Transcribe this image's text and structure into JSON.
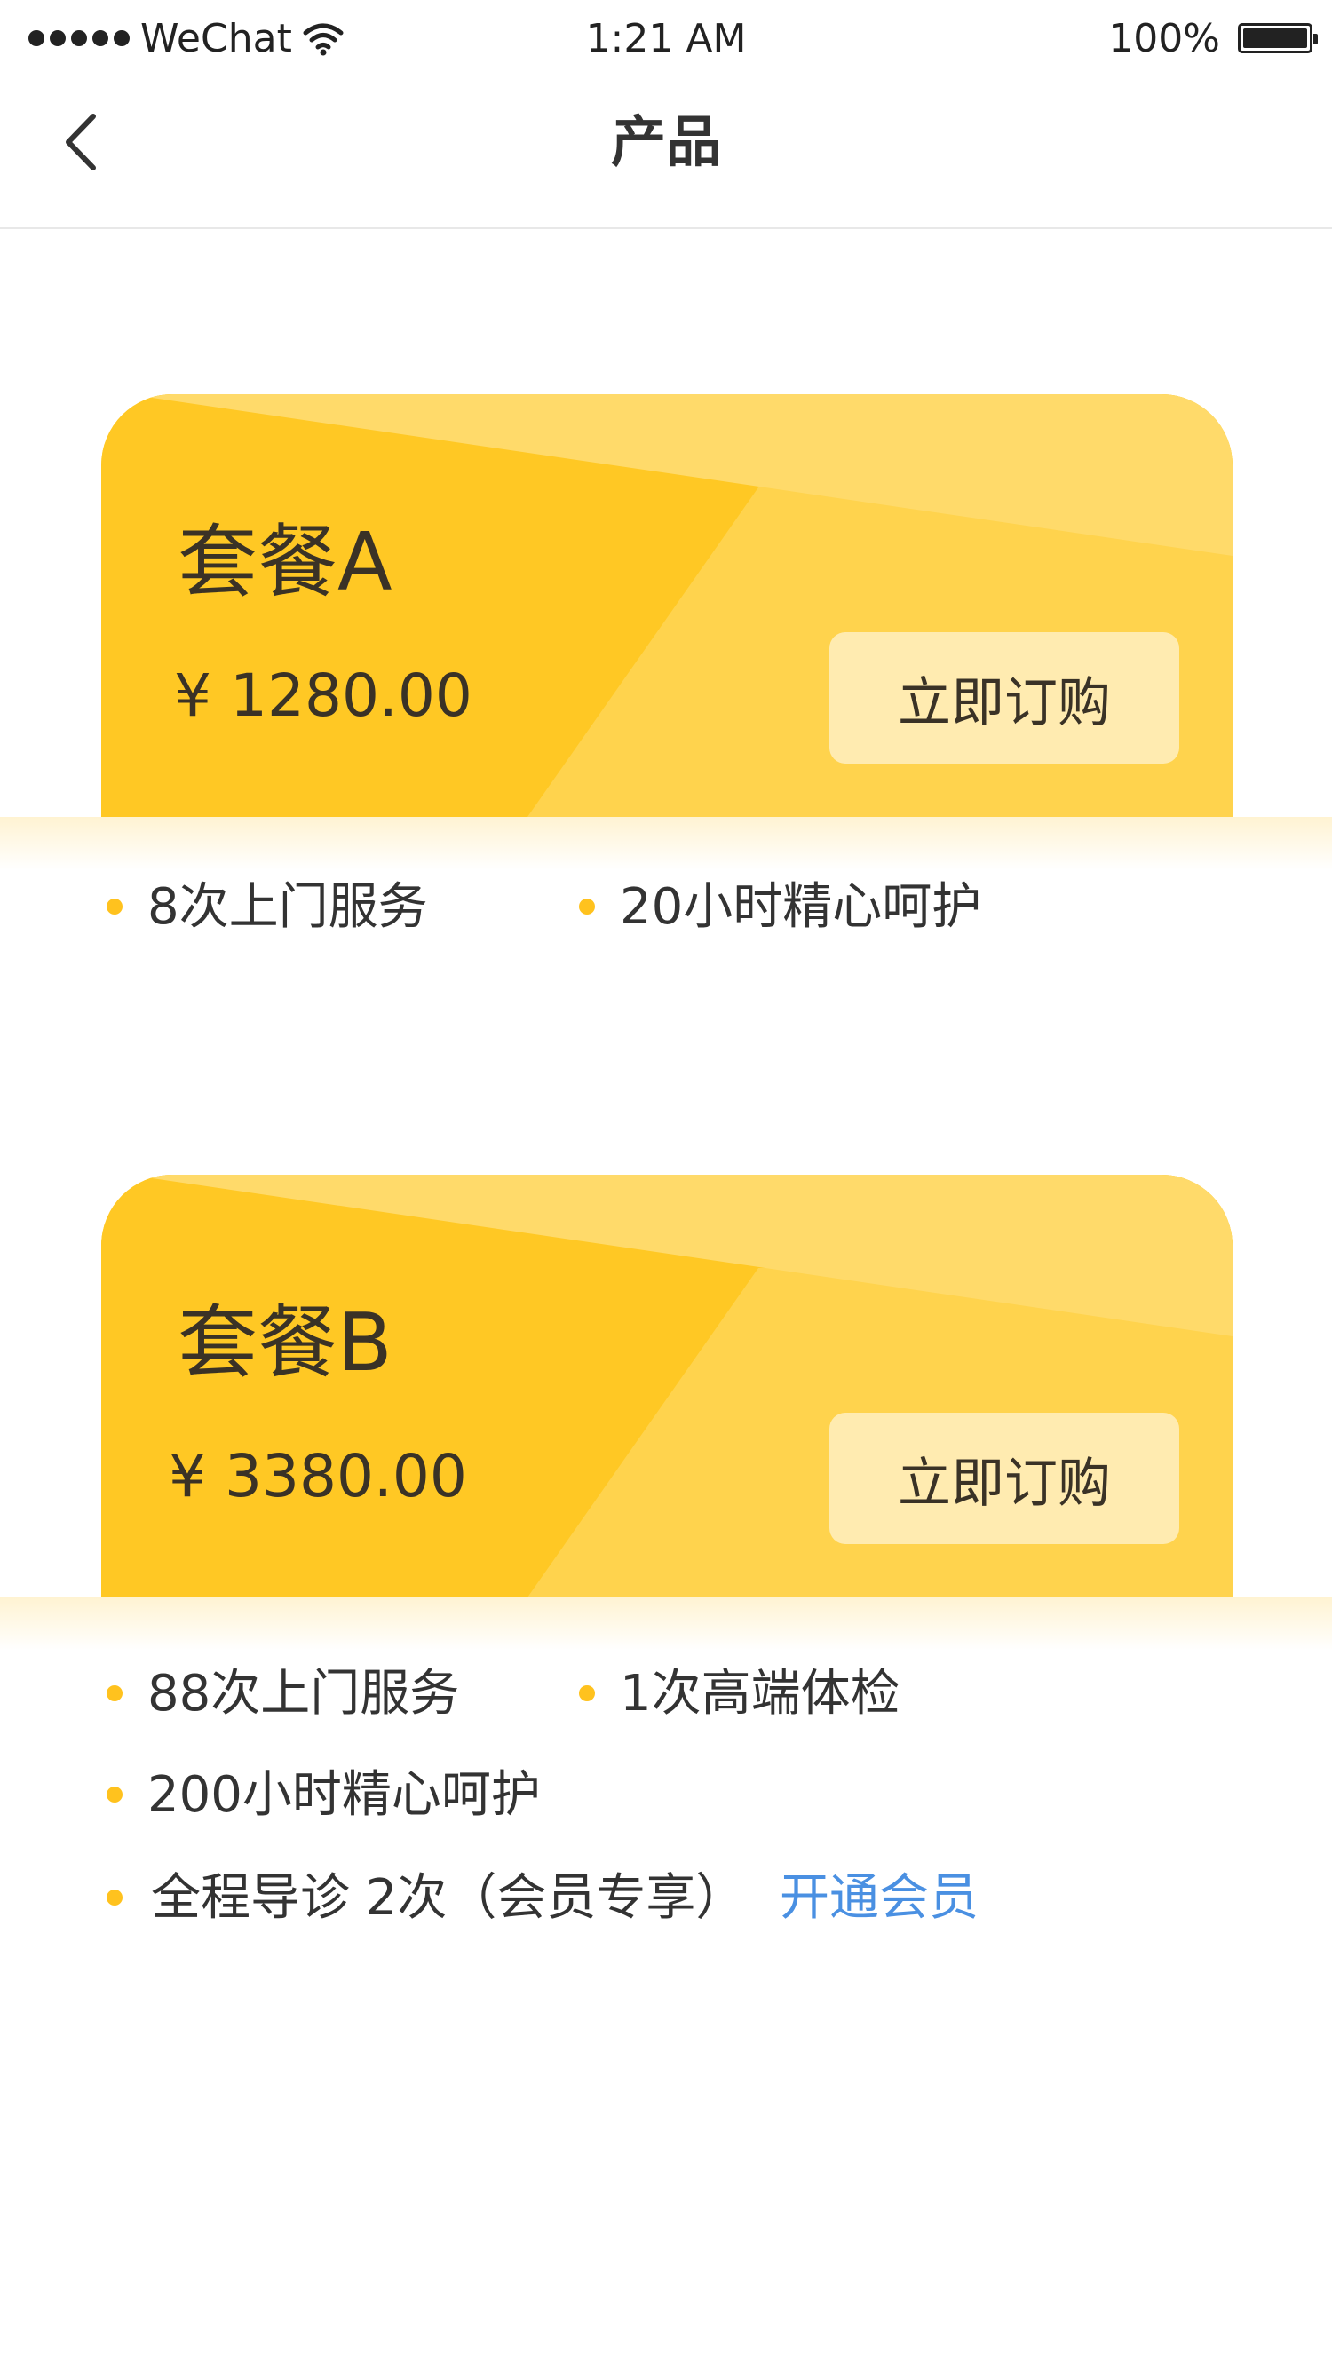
{
  "status_bar": {
    "carrier": "WeChat",
    "time": "1:21 AM",
    "battery": "100%"
  },
  "nav": {
    "title": "产品"
  },
  "colors": {
    "card_base": "#FFC824",
    "card_light": "#FFD34D",
    "card_lighter": "#FFDA6A",
    "button_bg": "#FFEBB0",
    "bullet": "#FFC21E",
    "link": "#4A90E2"
  },
  "packages": [
    {
      "name": "套餐A",
      "price": "¥ 1280.00",
      "button_label": "立即订购",
      "features": [
        "8次上门服务",
        "20小时精心呵护"
      ]
    },
    {
      "name": "套餐B",
      "price": "¥ 3380.00",
      "button_label": "立即订购",
      "features": [
        "88次上门服务",
        "1次高端体检",
        "200小时精心呵护",
        "全程导诊 2次（会员专享）"
      ],
      "member_link": "开通会员"
    }
  ]
}
